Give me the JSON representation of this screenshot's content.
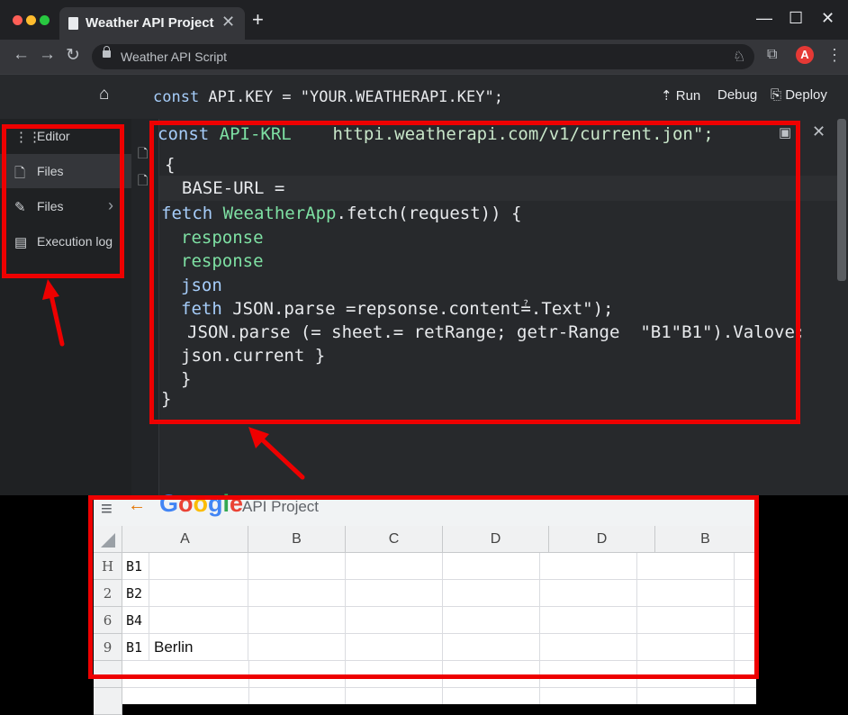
{
  "browser": {
    "tab_title": "Weather API Project",
    "tab_close": "✕",
    "new_tab": "+",
    "minimize": "—",
    "maximize": "☐",
    "close": "✕",
    "back": "←",
    "forward": "→",
    "reload": "↻",
    "address": "Weather API Script"
  },
  "toolbar": {
    "home_icon": "⌂",
    "code_kw": "const",
    "code_rest": " API.KEY = \"YOUR.WEATHERAPI.KEY\";",
    "run_icon": "⇡",
    "run_label": "Run",
    "debug_label": "Debug",
    "deploy_icon": "⎘",
    "deploy_label": "Deploy"
  },
  "sidebar": {
    "items": [
      {
        "icon": "⋮⋮",
        "label": "Editor"
      },
      {
        "icon": "🗋",
        "label": "Files"
      },
      {
        "icon": "✎",
        "label": "Files",
        "chevron": "›"
      },
      {
        "icon": "▤",
        "label": "Execution log"
      }
    ]
  },
  "editor": {
    "line1_kw": "const",
    "line1_name": "API-KRL",
    "line1_url": "httpi.weatherapi.com/v1/current.jon\";",
    "line2": "{",
    "line3": "  BASE-URL =",
    "line4_kw": "fetch",
    "line4_fn": "WeeatherApp",
    "line4_rest": ".fetch(request)) {",
    "line5": "response",
    "line6": "response",
    "line7": "json",
    "line8_kw": "feth",
    "line8_rest": " JSON.parse =repsonse.content≟.Text\");",
    "line9": "JSON.parse (= sheet.= retRange; getr-Range  \"B1\"B1\").Valove;",
    "line10": "json.current }",
    "line11": "}",
    "line12": "}",
    "panel_close": "✕",
    "panel_expand": "▣"
  },
  "sheets": {
    "title": "API Project",
    "logo": "Google",
    "menu_icon": "≡",
    "back_icon": "←",
    "columns": [
      "A",
      "B",
      "C",
      "D",
      "D",
      "B"
    ],
    "rows": [
      {
        "num": "H",
        "ref": "B1",
        "a": ""
      },
      {
        "num": "2",
        "ref": "B2",
        "a": ""
      },
      {
        "num": "6",
        "ref": "B4",
        "a": ""
      },
      {
        "num": "9",
        "ref": "B1",
        "a": "Berlin"
      }
    ]
  },
  "colors": {
    "annotation": "#ee0000",
    "ide_bg": "#27292c",
    "keyword": "#a6cdfa",
    "function": "#7ee0a3"
  }
}
